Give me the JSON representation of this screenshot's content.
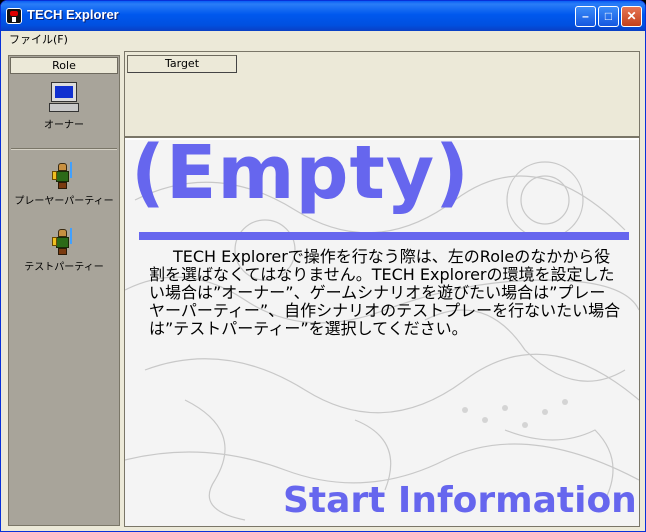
{
  "window": {
    "title": "TECH Explorer",
    "min_glyph": "–",
    "max_glyph": "□",
    "close_glyph": "✕"
  },
  "menu": {
    "file": "ファイル(F)"
  },
  "sidebar": {
    "header": "Role",
    "items": [
      {
        "label": "オーナー",
        "icon": "computer-icon"
      },
      {
        "label": "プレーヤーパーティー",
        "icon": "knight-icon"
      },
      {
        "label": "テストパーティー",
        "icon": "knight-icon"
      }
    ]
  },
  "target": {
    "header": "Target"
  },
  "content": {
    "empty_title": "(Empty)",
    "info_text": "TECH Explorerで操作を行なう際は、左のRoleのなかから役割を選ばなくてはなりません。TECH Explorerの環境を設定したい場合は”オーナー”、ゲームシナリオを遊びたい場合は”プレーヤーパーティー”、自作シナリオのテストプレーを行ないたい場合は”テストパーティー”を選択してください。",
    "footer_title": "Start Information"
  },
  "colors": {
    "accent": "#6666ee",
    "titlebar": "#0058ee"
  }
}
